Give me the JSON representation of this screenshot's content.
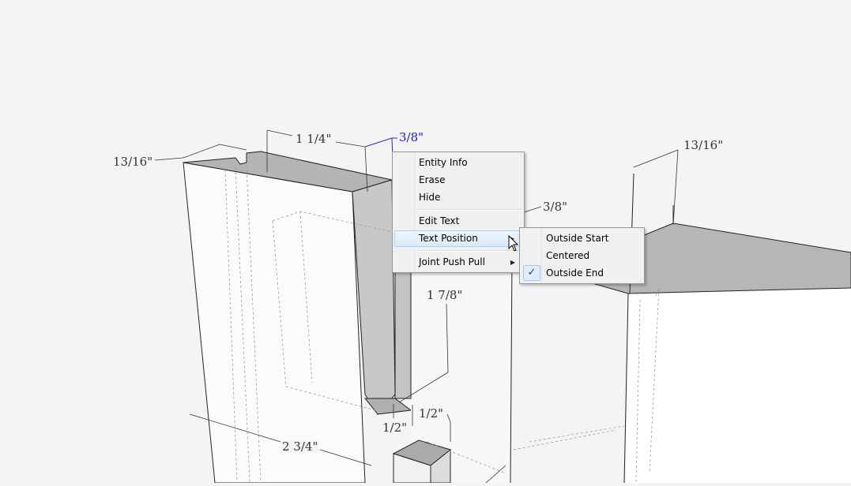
{
  "dimensions": {
    "d_13_16_left": "13/16\"",
    "d_1_1_4": "1 1/4\"",
    "d_3_8_top": "3/8\"",
    "d_13_16_right": "13/16\"",
    "d_3_8_mid": "3/8\"",
    "d_1_7_8": "1 7/8\"",
    "d_1_2_a": "1/2\"",
    "d_1_2_b": "1/2\"",
    "d_2_3_4": "2 3/4\""
  },
  "context_menu": {
    "entity_info": "Entity Info",
    "erase": "Erase",
    "hide": "Hide",
    "edit_text": "Edit Text",
    "text_position": "Text Position",
    "joint_push_pull": "Joint Push Pull"
  },
  "submenu": {
    "outside_start": "Outside Start",
    "centered": "Centered",
    "outside_end": "Outside End",
    "checked_icon": "check-icon"
  },
  "colors": {
    "background": "#f4f4f4",
    "selected_dimension": "#1a1acc",
    "menu_highlight": "#dbe9f9"
  }
}
